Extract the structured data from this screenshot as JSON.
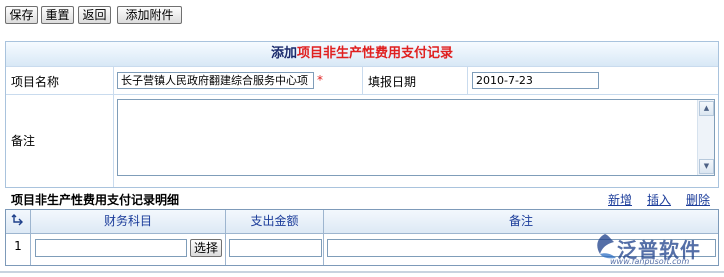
{
  "toolbar": {
    "save": "保存",
    "reset": "重置",
    "back": "返回",
    "add_attachment": "添加附件"
  },
  "form": {
    "title_prefix": "添加",
    "title_highlight": "项目非生产性费用支付记录",
    "project_name_label": "项目名称",
    "project_name_value": "长子营镇人民政府翻建综合服务中心项",
    "required_mark": "*",
    "fill_date_label": "填报日期",
    "fill_date_value": "2010-7-23",
    "remark_label": "备注",
    "remark_value": ""
  },
  "detail": {
    "title": "项目非生产性费用支付记录明细",
    "actions": {
      "add": "新增",
      "insert": "插入",
      "delete": "删除"
    },
    "columns": [
      "财务科目",
      "支出金额",
      "备注"
    ],
    "rows": [
      {
        "index": "1",
        "account": "",
        "select_label": "选择",
        "amount": "",
        "remark": ""
      }
    ]
  },
  "watermark": {
    "brand": "泛普软件",
    "url": "www.fanpusoft.com"
  },
  "colors": {
    "title_highlight": "#e02020",
    "link": "#1b3c9a",
    "border": "#a9c3dd"
  },
  "icons": {
    "grid_header": "row-indicator-icon",
    "scroll_up": "scroll-up-arrow-icon",
    "scroll_down": "scroll-down-arrow-icon",
    "logo": "fanpu-logo-icon"
  }
}
